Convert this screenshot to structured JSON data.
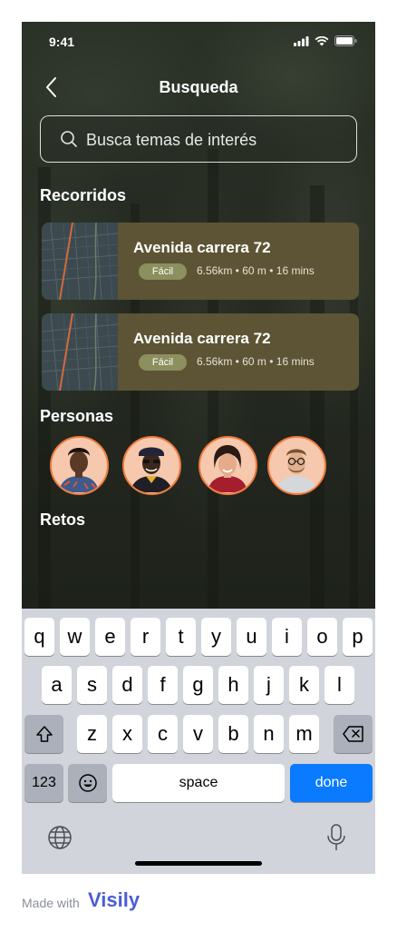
{
  "status_bar": {
    "time": "9:41"
  },
  "nav": {
    "title": "Busqueda"
  },
  "search": {
    "placeholder": "Busca temas de interés"
  },
  "sections": {
    "routes": "Recorridos",
    "people": "Personas",
    "challenges": "Retos"
  },
  "routes": [
    {
      "name": "Avenida carrera 72",
      "difficulty": "Fácil",
      "meta": "6.56km • 60 m • 16 mins"
    },
    {
      "name": "Avenida carrera 72",
      "difficulty": "Fácil",
      "meta": "6.56km • 60 m • 16 mins"
    }
  ],
  "people_count": 4,
  "keyboard": {
    "row1": [
      "q",
      "w",
      "e",
      "r",
      "t",
      "y",
      "u",
      "i",
      "o",
      "p"
    ],
    "row2": [
      "a",
      "s",
      "d",
      "f",
      "g",
      "h",
      "j",
      "k",
      "l"
    ],
    "row3": [
      "z",
      "x",
      "c",
      "v",
      "b",
      "n",
      "m"
    ],
    "numbers_label": "123",
    "space_label": "space",
    "done_label": "done"
  },
  "footer": {
    "made_with": "Made with",
    "brand": "Visily"
  },
  "colors": {
    "accent": "#f07a3c",
    "card": "#5c5434",
    "badge": "#8c8f5e",
    "done": "#0a7aff"
  }
}
